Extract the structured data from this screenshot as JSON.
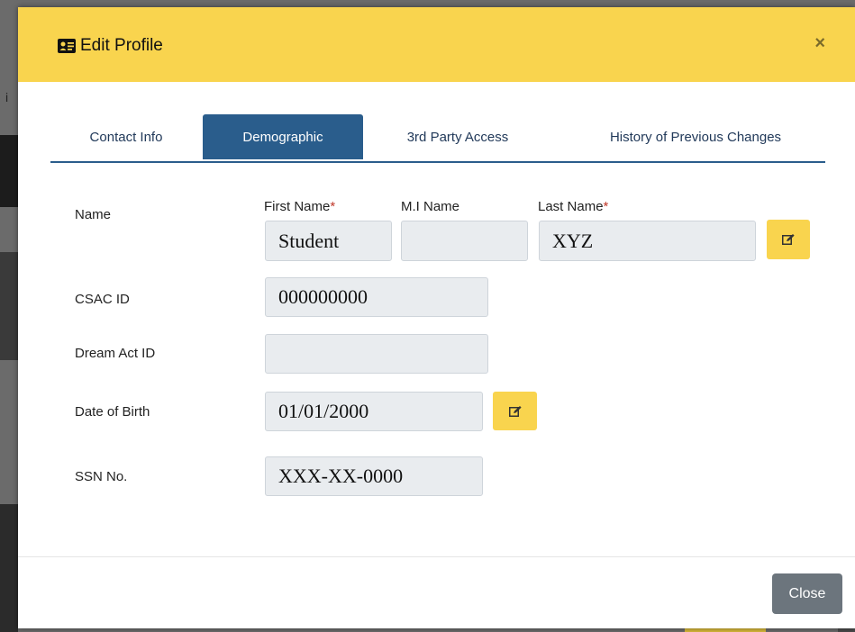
{
  "background": {
    "glyph": "i"
  },
  "modal": {
    "title": "Edit Profile",
    "title_icon": "id-card-icon",
    "close_symbol": "×",
    "header_color": "#f9d44e"
  },
  "tabs": [
    {
      "label": "Contact Info",
      "active": false
    },
    {
      "label": "Demographic",
      "active": true
    },
    {
      "label": "3rd Party Access",
      "active": false
    },
    {
      "label": "History of Previous Changes",
      "active": false
    }
  ],
  "form": {
    "name": {
      "label": "Name",
      "first_label": "First Name",
      "mi_label": "M.I Name",
      "last_label": "Last Name",
      "required_marker": "*",
      "first_value": "Student",
      "mi_value": "",
      "last_value": "XYZ"
    },
    "csac": {
      "label": "CSAC ID",
      "value": "000000000"
    },
    "dream": {
      "label": "Dream Act ID",
      "value": ""
    },
    "dob": {
      "label": "Date of Birth",
      "value": "01/01/2000"
    },
    "ssn": {
      "label": "SSN No.",
      "value": "XXX-XX-0000"
    }
  },
  "footer": {
    "close_label": "Close"
  },
  "icons": {
    "edit": "edit-icon"
  },
  "colors": {
    "accent": "#2a5d8c",
    "button_yellow": "#f9d44e",
    "close_gray": "#6c757d",
    "required": "#c0392b"
  }
}
